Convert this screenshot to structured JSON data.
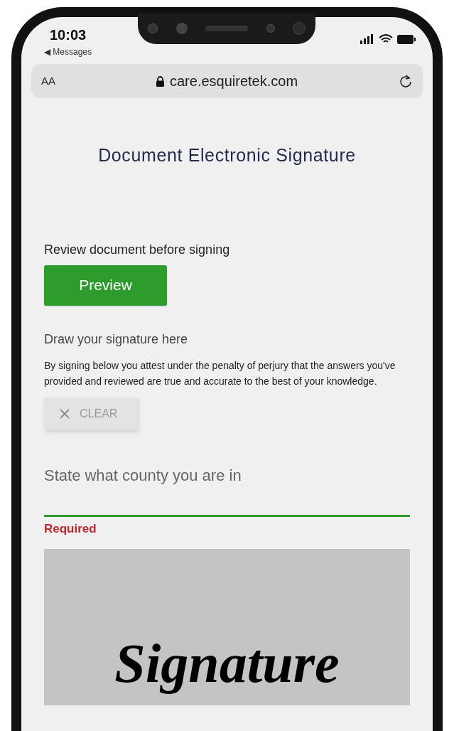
{
  "status_bar": {
    "time": "10:03",
    "back_label": "◀ Messages"
  },
  "browser": {
    "text_size_label": "AA",
    "url": "care.esquiretek.com"
  },
  "page": {
    "title": "Document Electronic Signature",
    "review_label": "Review document before signing",
    "preview_button": "Preview",
    "draw_label": "Draw your signature here",
    "attestation": "By signing below you attest under the penalty of perjury that the answers you've provided and reviewed are true and accurate to the best of your knowledge.",
    "clear_button": "CLEAR",
    "county_field": {
      "placeholder": "State what county you are in",
      "error": "Required"
    },
    "signature_pad": {
      "signature": "Signature"
    }
  }
}
